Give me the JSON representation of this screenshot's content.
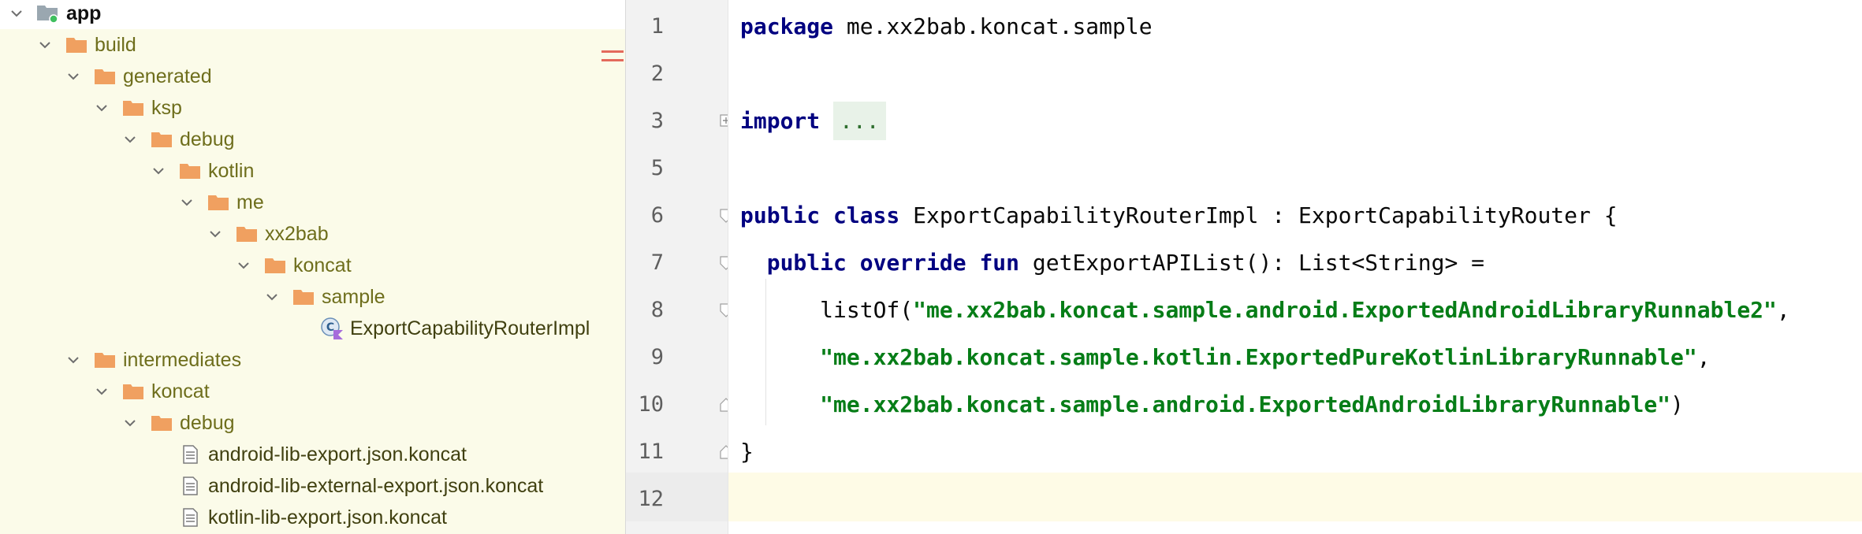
{
  "tree": {
    "items": [
      {
        "label": "app",
        "depth": 0,
        "icon": "module-folder-icon",
        "expanded": true,
        "kind": "root"
      },
      {
        "label": "build",
        "depth": 1,
        "icon": "folder-icon",
        "expanded": true
      },
      {
        "label": "generated",
        "depth": 2,
        "icon": "folder-icon",
        "expanded": true
      },
      {
        "label": "ksp",
        "depth": 3,
        "icon": "folder-icon",
        "expanded": true
      },
      {
        "label": "debug",
        "depth": 4,
        "icon": "folder-icon",
        "expanded": true
      },
      {
        "label": "kotlin",
        "depth": 5,
        "icon": "folder-icon",
        "expanded": true
      },
      {
        "label": "me",
        "depth": 6,
        "icon": "folder-icon",
        "expanded": true
      },
      {
        "label": "xx2bab",
        "depth": 7,
        "icon": "folder-icon",
        "expanded": true
      },
      {
        "label": "koncat",
        "depth": 8,
        "icon": "folder-icon",
        "expanded": true
      },
      {
        "label": "sample",
        "depth": 9,
        "icon": "folder-icon",
        "expanded": true
      },
      {
        "label": "ExportCapabilityRouterImpl",
        "depth": 10,
        "icon": "kotlin-class-icon",
        "expanded": null
      },
      {
        "label": "intermediates",
        "depth": 2,
        "icon": "folder-icon",
        "expanded": true
      },
      {
        "label": "koncat",
        "depth": 3,
        "icon": "folder-icon",
        "expanded": true
      },
      {
        "label": "debug",
        "depth": 4,
        "icon": "folder-icon",
        "expanded": true
      },
      {
        "label": "android-lib-export.json.koncat",
        "depth": 5,
        "icon": "text-file-icon",
        "expanded": null
      },
      {
        "label": "android-lib-external-export.json.koncat",
        "depth": 5,
        "icon": "text-file-icon",
        "expanded": null
      },
      {
        "label": "kotlin-lib-export.json.koncat",
        "depth": 5,
        "icon": "text-file-icon",
        "expanded": null
      }
    ]
  },
  "editor": {
    "lines": [
      {
        "number": "1",
        "tokens": [
          {
            "t": "package",
            "c": "kw"
          },
          {
            "t": " me.xx2bab.koncat.sample",
            "c": ""
          }
        ],
        "fold": null
      },
      {
        "number": "2",
        "tokens": [],
        "fold": null
      },
      {
        "number": "3",
        "tokens": [
          {
            "t": "import",
            "c": "kw"
          },
          {
            "t": " ",
            "c": ""
          },
          {
            "t": "...",
            "c": "fold-placeholder"
          }
        ],
        "fold": "plus"
      },
      {
        "number": "5",
        "tokens": [],
        "fold": null
      },
      {
        "number": "6",
        "tokens": [
          {
            "t": "public class",
            "c": "kw"
          },
          {
            "t": " ExportCapabilityRouterImpl : ExportCapabilityRouter {",
            "c": ""
          }
        ],
        "fold": "open"
      },
      {
        "number": "7",
        "tokens": [
          {
            "t": "  ",
            "c": ""
          },
          {
            "t": "public override fun",
            "c": "kw"
          },
          {
            "t": " getExportAPIList(): List<String> =",
            "c": ""
          }
        ],
        "fold": "open"
      },
      {
        "number": "8",
        "tokens": [
          {
            "t": "      listOf(",
            "c": ""
          },
          {
            "t": "\"me.xx2bab.koncat.sample.android.ExportedAndroidLibraryRunnable2\"",
            "c": "str"
          },
          {
            "t": ",",
            "c": ""
          }
        ],
        "fold": "open"
      },
      {
        "number": "9",
        "tokens": [
          {
            "t": "      ",
            "c": ""
          },
          {
            "t": "\"me.xx2bab.koncat.sample.kotlin.ExportedPureKotlinLibraryRunnable\"",
            "c": "str"
          },
          {
            "t": ",",
            "c": ""
          }
        ],
        "fold": null
      },
      {
        "number": "10",
        "tokens": [
          {
            "t": "      ",
            "c": ""
          },
          {
            "t": "\"me.xx2bab.koncat.sample.android.ExportedAndroidLibraryRunnable\"",
            "c": "str"
          },
          {
            "t": ")",
            "c": ""
          }
        ],
        "fold": "close"
      },
      {
        "number": "11",
        "tokens": [
          {
            "t": "}",
            "c": ""
          }
        ],
        "fold": "close"
      },
      {
        "number": "12",
        "tokens": [],
        "fold": null
      }
    ]
  },
  "colors": {
    "keyword": "#000080",
    "string": "#067d17",
    "folder": "#f0a060",
    "tree_highlight": "#fbfbe9",
    "current_line": "#fefbe6"
  }
}
